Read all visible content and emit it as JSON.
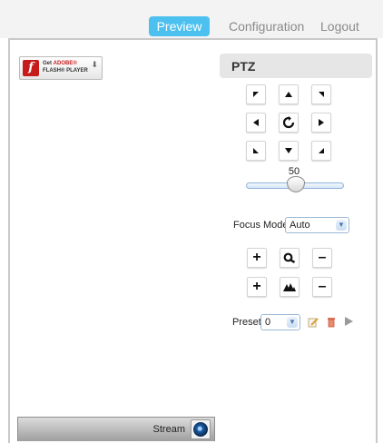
{
  "nav": {
    "tabs": [
      {
        "label": "Preview",
        "active": true
      },
      {
        "label": "Configuration",
        "active": false
      },
      {
        "label": "Logout",
        "active": false
      }
    ]
  },
  "flash_badge": {
    "line1_prefix": "Get ",
    "line1_brand": "ADOBE®",
    "line2": "FLASH® PLAYER",
    "icon": "flash-logo-icon"
  },
  "ptz": {
    "title": "PTZ",
    "directions": [
      {
        "name": "up-left",
        "icon": "arrow-up-left-icon"
      },
      {
        "name": "up",
        "icon": "arrow-up-icon"
      },
      {
        "name": "up-right",
        "icon": "arrow-up-right-icon"
      },
      {
        "name": "left",
        "icon": "arrow-left-icon"
      },
      {
        "name": "home",
        "icon": "refresh-icon"
      },
      {
        "name": "right",
        "icon": "arrow-right-icon"
      },
      {
        "name": "down-left",
        "icon": "arrow-down-left-icon"
      },
      {
        "name": "down",
        "icon": "arrow-down-icon"
      },
      {
        "name": "down-right",
        "icon": "arrow-down-right-icon"
      }
    ],
    "speed": {
      "value": "50",
      "fraction": 0.5
    }
  },
  "focus": {
    "label": "Focus Mode",
    "selected": "Auto"
  },
  "zoom_controls": [
    {
      "name": "zoom-in",
      "label": "+"
    },
    {
      "name": "zoom",
      "icon": "magnifier-icon"
    },
    {
      "name": "zoom-out",
      "label": "–"
    }
  ],
  "focus_controls": [
    {
      "name": "focus-near",
      "label": "+"
    },
    {
      "name": "focus",
      "icon": "mountain-icon"
    },
    {
      "name": "focus-far",
      "label": "–"
    }
  ],
  "preset": {
    "label": "Preset",
    "selected": "0",
    "actions": [
      "edit-icon",
      "delete-icon",
      "play-icon"
    ]
  },
  "stream": {
    "label": "Stream",
    "icon": "camera-lens-icon"
  },
  "colors": {
    "accent": "#4cc0ee",
    "nav_bg": "#f3f3f3",
    "flash_red": "#c71b1b"
  }
}
